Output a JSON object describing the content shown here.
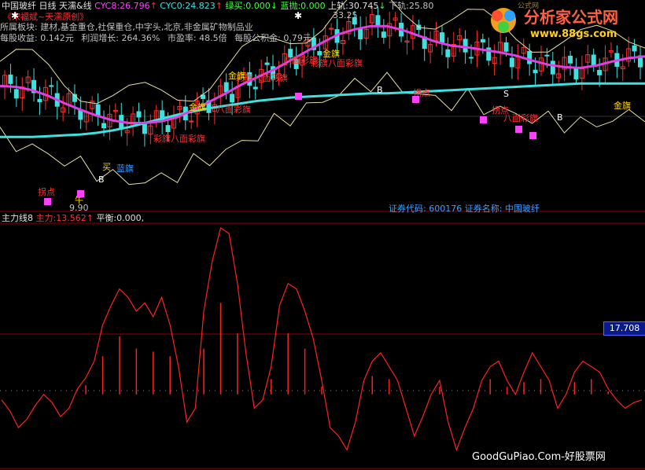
{
  "header": {
    "stock_name": "中国玻纤",
    "period": "日线",
    "indicator": "天濡&线",
    "cyc8_label": "CYC8:",
    "cyc8_value": "26.796",
    "cyc8_arrow": "↑",
    "cyc0_label": "CYC0:",
    "cyc0_value": "24.823",
    "cyc0_arrow": "↑",
    "green_buy_label": "绿买:",
    "green_buy_value": "0.000",
    "green_buy_arrow": "↓",
    "blue_sell_label": "蓝抛:",
    "blue_sell_value": "0.000",
    "upper_label": "上轨:",
    "upper_value": "30.745",
    "upper_arrow": "↓",
    "lower_label": "下轨:",
    "lower_value": "25.80",
    "author": "《宋福斌~天濡原创》",
    "price_high_label": "33.25",
    "price_low_label": "9.90"
  },
  "info": {
    "sector_label": "所属板块:",
    "sector_value": "建材,基金重仓,社保重仓,中字头,北京,非金属矿物制品业",
    "eps_label": "每股收益:",
    "eps_value": "0.142元",
    "profit_growth_label": "利润增长:",
    "profit_growth_value": "264.36%",
    "pe_label": "市盈率:",
    "pe_value": "48.5倍",
    "nav_label": "每股公积金:",
    "nav_value": "0.79元"
  },
  "stock_id_line": "证券代码: 600176  证券名称: 中国玻纤",
  "lower_panel": {
    "name": "主力线8",
    "zhuli_label": "主力:",
    "zhuli_value": "13.562",
    "zhuli_arrow": "↑",
    "balance_label": "平衡:",
    "balance_value": "0.000,",
    "current_value_box": "17.708"
  },
  "logo": {
    "title": "分析家公式网",
    "url": "www.88gs.com",
    "small": "公式网"
  },
  "footer": "GoodGuPiao.Com-好股票网",
  "annotations": [
    {
      "text": "彩旗八面彩旗",
      "color": "#ff3030"
    },
    {
      "text": "八面彩旗",
      "color": "#ff3030"
    },
    {
      "text": "金旗",
      "color": "#ffd700"
    },
    {
      "text": "买",
      "color": "#ffd700"
    },
    {
      "text": "B",
      "color": "#ffffff"
    },
    {
      "text": "S",
      "color": "#ffffff"
    },
    {
      "text": "拐点",
      "color": "#ff3030"
    },
    {
      "text": "蓝旗",
      "color": "#3399ff"
    },
    {
      "text": "牛",
      "color": "#ffd700"
    }
  ],
  "colors": {
    "background": "#000000",
    "ma_magenta": "#e040e0",
    "ma_cyan": "#40e0e0",
    "band_yellow": "#e8e0a0",
    "up_candle": "#ff3030",
    "down_candle": "#40e0e0",
    "indicator_line": "#ff2020",
    "grid_red": "#8b0000"
  },
  "chart_data": [
    {
      "type": "line",
      "title": "中国玻纤 日线",
      "series": [
        {
          "name": "CYC8",
          "values": [
            24.5,
            24.4,
            24.0,
            23.3,
            22.4,
            21.6,
            20.9,
            20.3,
            20.0,
            20.0,
            20.2,
            20.7,
            21.6,
            22.6,
            23.6,
            24.7,
            25.6,
            26.5,
            27.6,
            28.7,
            29.8,
            30.8,
            31.4,
            31.8,
            31.8,
            31.3,
            30.6,
            29.9,
            29.4,
            29.2,
            28.9,
            28.6,
            28.2,
            27.6,
            27.1,
            26.8,
            26.7,
            27.0,
            27.5,
            27.9,
            28.1
          ]
        },
        {
          "name": "CYC0",
          "values": [
            18.3,
            18.3,
            18.3,
            18.4,
            18.5,
            18.6,
            18.8,
            19.1,
            19.5,
            20.0,
            20.5,
            21.0,
            21.4,
            21.8,
            22.1,
            22.4,
            22.7,
            22.9,
            23.1,
            23.2,
            23.3,
            23.4,
            23.5,
            23.6,
            23.6,
            23.7,
            23.8,
            23.9,
            24.0,
            24.1,
            24.2,
            24.3,
            24.4,
            24.5,
            24.6,
            24.7,
            24.8,
            24.8,
            24.8,
            24.8,
            24.8
          ]
        }
      ],
      "ylim": [
        9.9,
        33.25
      ],
      "price_high": 33.25,
      "price_low": 9.9
    },
    {
      "type": "line",
      "title": "主力线8",
      "series": [
        {
          "name": "主力",
          "values": [
            -2,
            -6,
            -12,
            -9,
            -4,
            0,
            -3,
            -8,
            -5,
            2,
            6,
            12,
            25,
            32,
            38,
            35,
            30,
            33,
            28,
            35,
            25,
            10,
            -10,
            -5,
            30,
            48,
            60,
            58,
            40,
            15,
            -5,
            -2,
            10,
            32,
            40,
            38,
            30,
            20,
            5,
            -12,
            -15,
            -20,
            -10,
            5,
            12,
            15,
            10,
            5,
            -5,
            -15,
            -8,
            0,
            5,
            -10,
            -20,
            -12,
            -5,
            5,
            10,
            12,
            5,
            0,
            8,
            15,
            10,
            5,
            -5,
            0,
            8,
            12,
            10,
            8,
            2,
            -2,
            -5,
            -3,
            -2
          ]
        },
        {
          "name": "平衡",
          "values": [
            0,
            0,
            0,
            0,
            0,
            0,
            0,
            0,
            0,
            0,
            0,
            0,
            0,
            0,
            0,
            0,
            0,
            0,
            0,
            0,
            0,
            0,
            0,
            0,
            0,
            0,
            0,
            0,
            0,
            0,
            0,
            0,
            0,
            0,
            0,
            0,
            0,
            0,
            0,
            0,
            0,
            0,
            0,
            0,
            0,
            0,
            0,
            0,
            0,
            0,
            0,
            0,
            0,
            0,
            0,
            0,
            0,
            0,
            0,
            0,
            0,
            0,
            0,
            0,
            0,
            0,
            0,
            0,
            0,
            0,
            0,
            0,
            0,
            0,
            0,
            0,
            0
          ]
        }
      ],
      "current_value": 13.562
    }
  ]
}
